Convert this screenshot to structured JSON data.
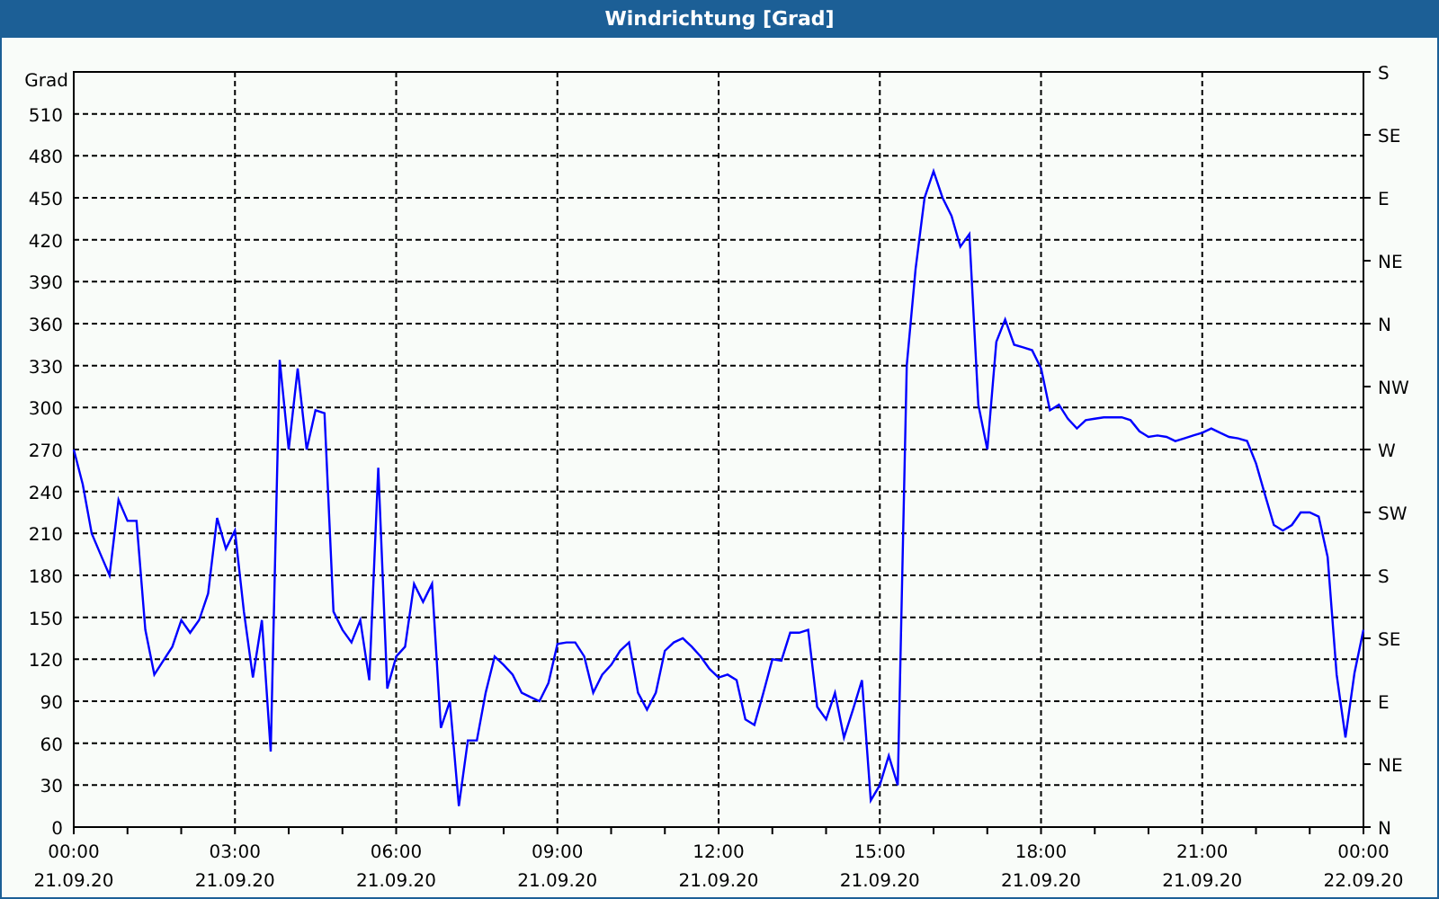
{
  "window": {
    "title": "Windrichtung [Grad]"
  },
  "chart": {
    "right_axis_labels": [
      "S",
      "SE",
      "E",
      "NE",
      "N",
      "NW",
      "W",
      "SW",
      "S",
      "SE",
      "E",
      "NE",
      "N"
    ],
    "chart_data": {
      "type": "line",
      "ylabel": "Grad",
      "ylim": [
        0,
        540
      ],
      "grid": true,
      "yticks": [
        0,
        30,
        60,
        90,
        120,
        150,
        180,
        210,
        240,
        270,
        300,
        330,
        360,
        390,
        420,
        450,
        480,
        510
      ],
      "categories": [
        "00:00\n21.09.20",
        null,
        null,
        null,
        null,
        null,
        null,
        null,
        null,
        null,
        null,
        null,
        null,
        null,
        null,
        null,
        null,
        null,
        "03:00\n21.09.20",
        null,
        null,
        null,
        null,
        null,
        null,
        null,
        null,
        null,
        null,
        null,
        null,
        null,
        null,
        null,
        null,
        null,
        "06:00\n21.09.20",
        null,
        null,
        null,
        null,
        null,
        null,
        null,
        null,
        null,
        null,
        null,
        null,
        null,
        null,
        null,
        null,
        null,
        "09:00\n21.09.20",
        null,
        null,
        null,
        null,
        null,
        null,
        null,
        null,
        null,
        null,
        null,
        null,
        null,
        null,
        null,
        null,
        null,
        "12:00\n21.09.20",
        null,
        null,
        null,
        null,
        null,
        null,
        null,
        null,
        null,
        null,
        null,
        null,
        null,
        null,
        null,
        null,
        null,
        "15:00\n21.09.20",
        null,
        null,
        null,
        null,
        null,
        null,
        null,
        null,
        null,
        null,
        null,
        null,
        null,
        null,
        null,
        null,
        null,
        "18:00\n21.09.20",
        null,
        null,
        null,
        null,
        null,
        null,
        null,
        null,
        null,
        null,
        null,
        null,
        null,
        null,
        null,
        null,
        null,
        "21:00\n21.09.20",
        null,
        null,
        null,
        null,
        null,
        null,
        null,
        null,
        null,
        null,
        null,
        null,
        null,
        null,
        null,
        null,
        null,
        "00:00\n22.09.20"
      ],
      "series": [
        {
          "color": "#0000ff",
          "values": [
            270,
            245,
            210,
            195,
            180,
            234,
            219,
            219,
            141,
            109,
            119,
            129,
            148,
            139,
            148,
            167,
            221,
            199,
            212,
            154,
            107,
            148,
            54,
            334,
            270,
            328,
            270,
            298,
            296,
            154,
            141,
            132,
            148,
            105,
            257,
            99,
            122,
            129,
            174,
            161,
            174,
            71,
            90,
            15,
            62,
            62,
            96,
            122,
            116,
            109,
            96,
            93,
            90,
            103,
            131,
            132,
            132,
            122,
            96,
            109,
            116,
            126,
            132,
            96,
            84,
            96,
            126,
            132,
            135,
            129,
            122,
            113,
            107,
            109,
            105,
            77,
            73,
            96,
            120,
            119,
            139,
            139,
            141,
            86,
            77,
            96,
            64,
            84,
            105,
            19,
            30,
            51,
            30,
            330,
            399,
            450,
            469,
            450,
            437,
            415,
            424,
            302,
            270,
            347,
            363,
            345,
            343,
            341,
            328,
            298,
            302,
            292,
            285,
            291,
            292,
            293,
            293,
            293,
            291,
            283,
            279,
            280,
            279,
            276,
            278,
            280,
            282,
            285,
            282,
            279,
            278,
            276,
            260,
            238,
            216,
            212,
            216,
            225,
            225,
            222,
            193,
            109,
            64,
            110,
            141
          ]
        }
      ]
    }
  }
}
